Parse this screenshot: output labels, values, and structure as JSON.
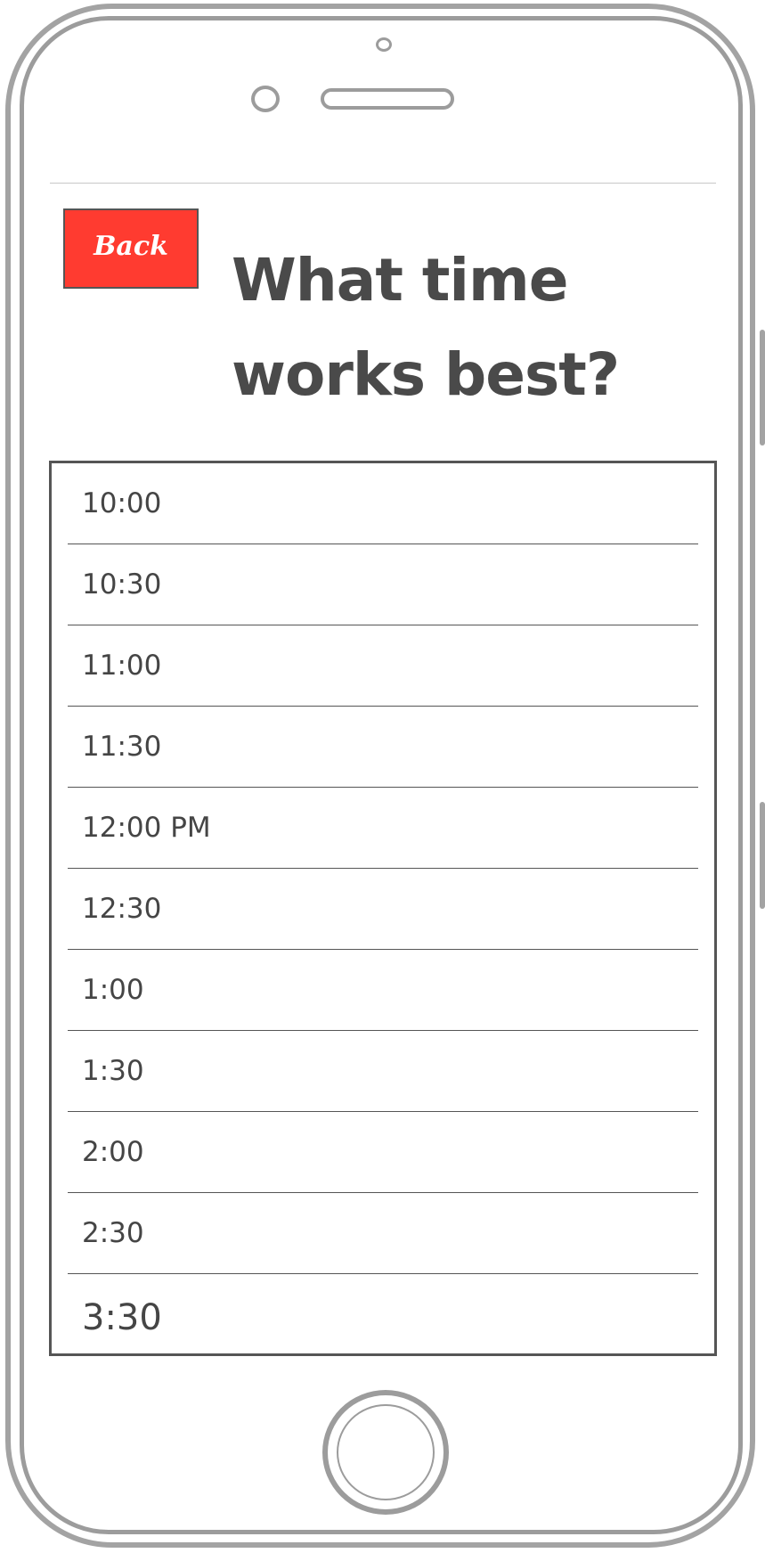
{
  "header": {
    "back_label": "Back",
    "title_line1": "What time",
    "title_line2": "works best?"
  },
  "time_slots": [
    "10:00",
    "10:30",
    "11:00",
    "11:30",
    "12:00 PM",
    "12:30",
    "1:00",
    "1:30",
    "2:00",
    "2:30",
    "3:30"
  ],
  "colors": {
    "back_button": "#ff3b30",
    "text": "#4a4a4a",
    "frame": "#a3a3a3"
  }
}
